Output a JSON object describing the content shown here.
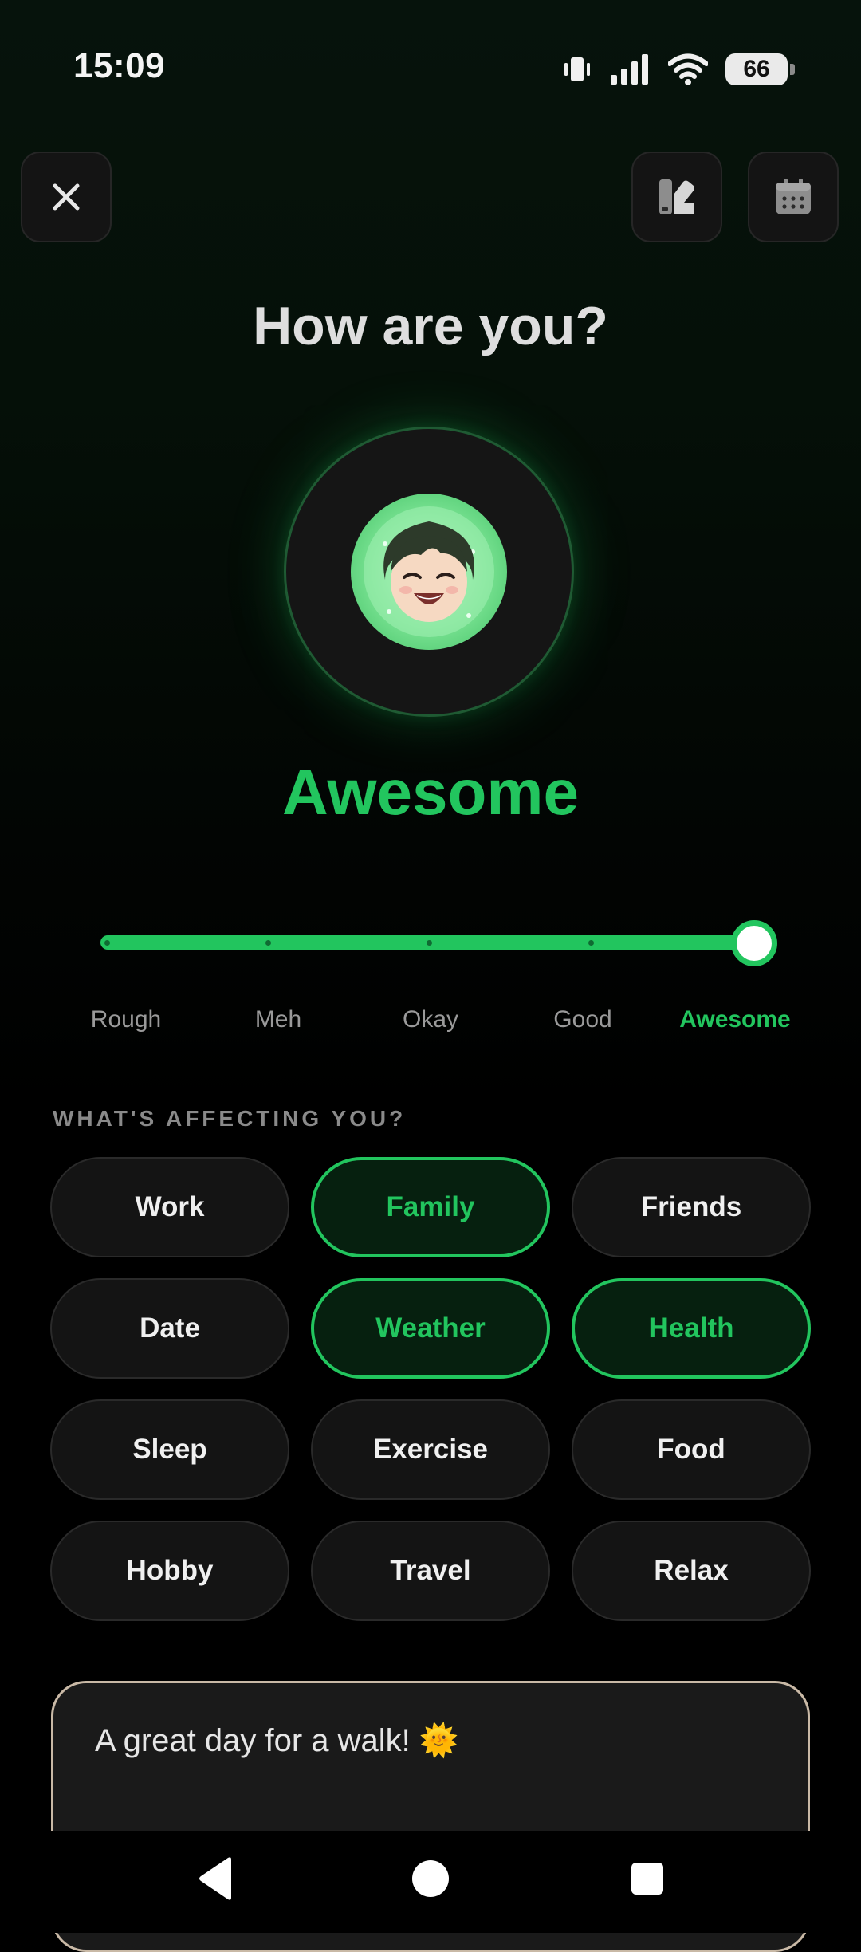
{
  "status": {
    "time": "15:09",
    "battery": "66"
  },
  "header": {
    "title": "How are you?"
  },
  "mood": {
    "current": "Awesome",
    "selected_index": 4,
    "scale": [
      "Rough",
      "Meh",
      "Okay",
      "Good",
      "Awesome"
    ]
  },
  "factors": {
    "heading": "WHAT'S AFFECTING YOU?",
    "chips": [
      {
        "label": "Work",
        "selected": false
      },
      {
        "label": "Family",
        "selected": true
      },
      {
        "label": "Friends",
        "selected": false
      },
      {
        "label": "Date",
        "selected": false
      },
      {
        "label": "Weather",
        "selected": true
      },
      {
        "label": "Health",
        "selected": true
      },
      {
        "label": "Sleep",
        "selected": false
      },
      {
        "label": "Exercise",
        "selected": false
      },
      {
        "label": "Food",
        "selected": false
      },
      {
        "label": "Hobby",
        "selected": false
      },
      {
        "label": "Travel",
        "selected": false
      },
      {
        "label": "Relax",
        "selected": false
      }
    ]
  },
  "note": {
    "text": "A great day for a walk! 🌞"
  },
  "colors": {
    "accent": "#22c55e",
    "background": "#000000",
    "card": "#141414"
  },
  "icons": {
    "close": "close-icon",
    "palette": "palette-icon",
    "calendar": "calendar-icon",
    "avatar": "happy-face-avatar"
  }
}
